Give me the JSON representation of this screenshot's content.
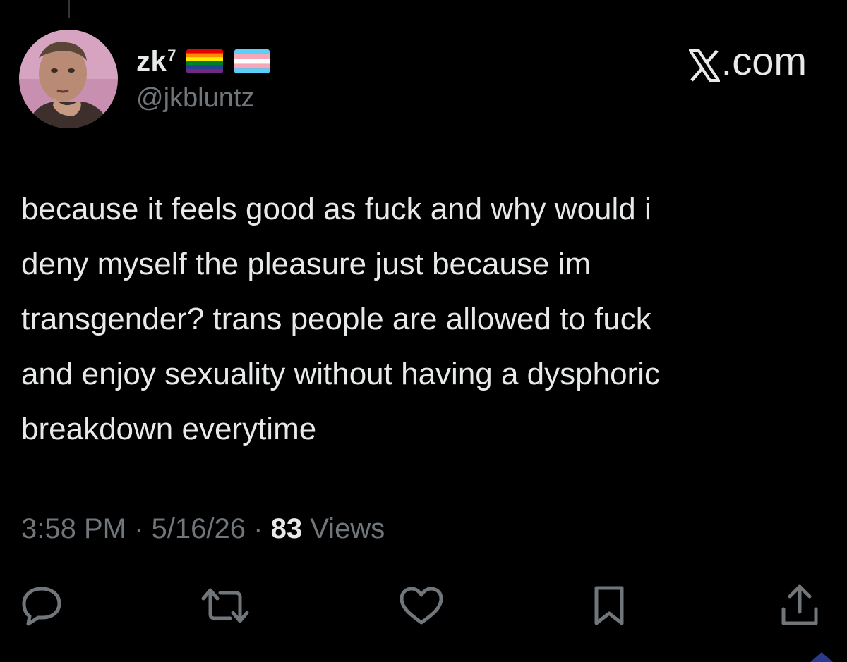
{
  "post": {
    "display_name": "zk",
    "display_name_sup": "7",
    "handle": "@jkbluntz",
    "badges": [
      "rainbow-flag-icon",
      "transgender-flag-icon"
    ],
    "site_label": ".com",
    "text_lines": [
      "because it feels good as fuck and why would i",
      "deny myself the pleasure just because im",
      "transgender? trans people are allowed to fuck",
      "and enjoy sexuality without having a dysphoric",
      "breakdown everytime"
    ],
    "time": "3:58 PM",
    "separator": "·",
    "date": "5/16/26",
    "views_count": "83",
    "views_label": "Views"
  },
  "actions": [
    {
      "name": "reply-icon"
    },
    {
      "name": "repost-icon"
    },
    {
      "name": "like-icon"
    },
    {
      "name": "bookmark-icon"
    },
    {
      "name": "share-icon"
    }
  ],
  "colors": {
    "background": "#000000",
    "primary_text": "#e7e9ea",
    "secondary_text": "#71767b",
    "icon": "#71767b"
  }
}
